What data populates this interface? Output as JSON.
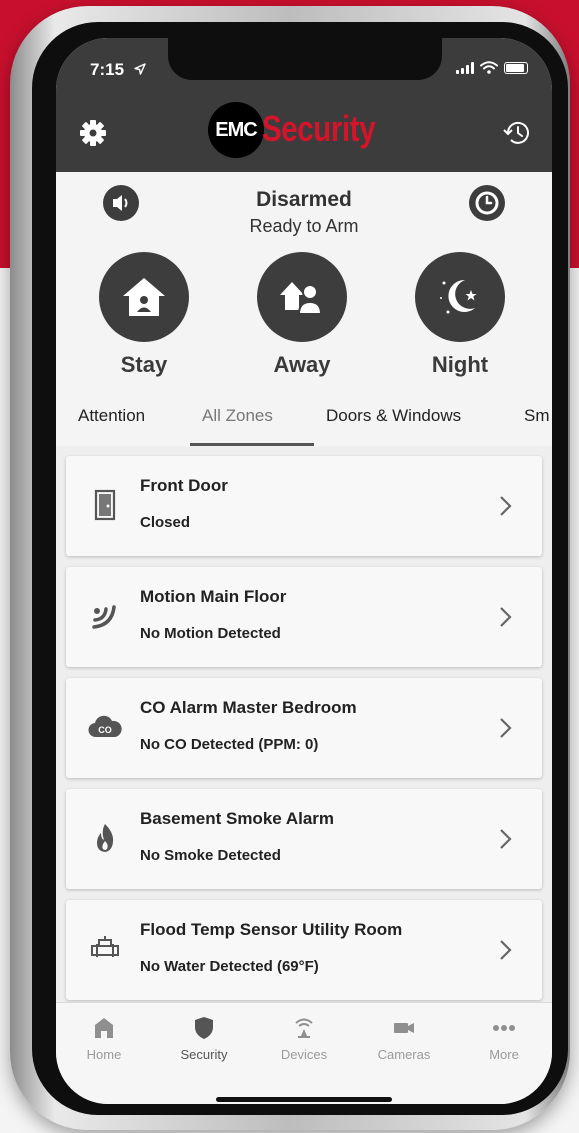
{
  "colors": {
    "brand_red": "#c8102e",
    "header_dark": "#3c3c3c",
    "mode_circle": "#3d3d3d"
  },
  "status_bar": {
    "time": "7:15",
    "icons": [
      "location-arrow-icon",
      "signal-bars-icon",
      "wifi-icon",
      "battery-icon"
    ]
  },
  "header": {
    "logo_circle_text": "EMC",
    "logo_word": "Security",
    "left_icon": "gear-icon",
    "right_icon": "history-icon"
  },
  "arm_panel": {
    "status_title": "Disarmed",
    "status_subtitle": "Ready to Arm",
    "speaker_icon": "speaker-icon",
    "clock_icon": "clock-icon",
    "modes": [
      {
        "label": "Stay",
        "icon": "house-icon"
      },
      {
        "label": "Away",
        "icon": "user-away-icon"
      },
      {
        "label": "Night",
        "icon": "moon-stars-icon"
      }
    ]
  },
  "tabs": [
    {
      "label": "Attention",
      "active": false
    },
    {
      "label": "All Zones",
      "active": true
    },
    {
      "label": "Doors & Windows",
      "active": false
    },
    {
      "label": "Sm",
      "active": false
    }
  ],
  "zones": [
    {
      "name": "Front Door",
      "status": "Closed",
      "icon": "door-icon"
    },
    {
      "name": "Motion Main Floor",
      "status": "No Motion Detected",
      "icon": "motion-icon"
    },
    {
      "name": "CO Alarm Master Bedroom",
      "status": "No CO Detected (PPM: 0)",
      "icon": "co-cloud-icon"
    },
    {
      "name": "Basement Smoke Alarm",
      "status": "No Smoke Detected",
      "icon": "flame-icon"
    },
    {
      "name": "Flood Temp Sensor Utility Room",
      "status": "No Water Detected (69°F)",
      "icon": "pipe-icon"
    }
  ],
  "tabbar": [
    {
      "label": "Home",
      "icon": "home-icon",
      "active": false
    },
    {
      "label": "Security",
      "icon": "shield-icon",
      "active": true
    },
    {
      "label": "Devices",
      "icon": "wireless-icon",
      "active": false
    },
    {
      "label": "Cameras",
      "icon": "camera-icon",
      "active": false
    },
    {
      "label": "More",
      "icon": "more-dots-icon",
      "active": false
    }
  ]
}
